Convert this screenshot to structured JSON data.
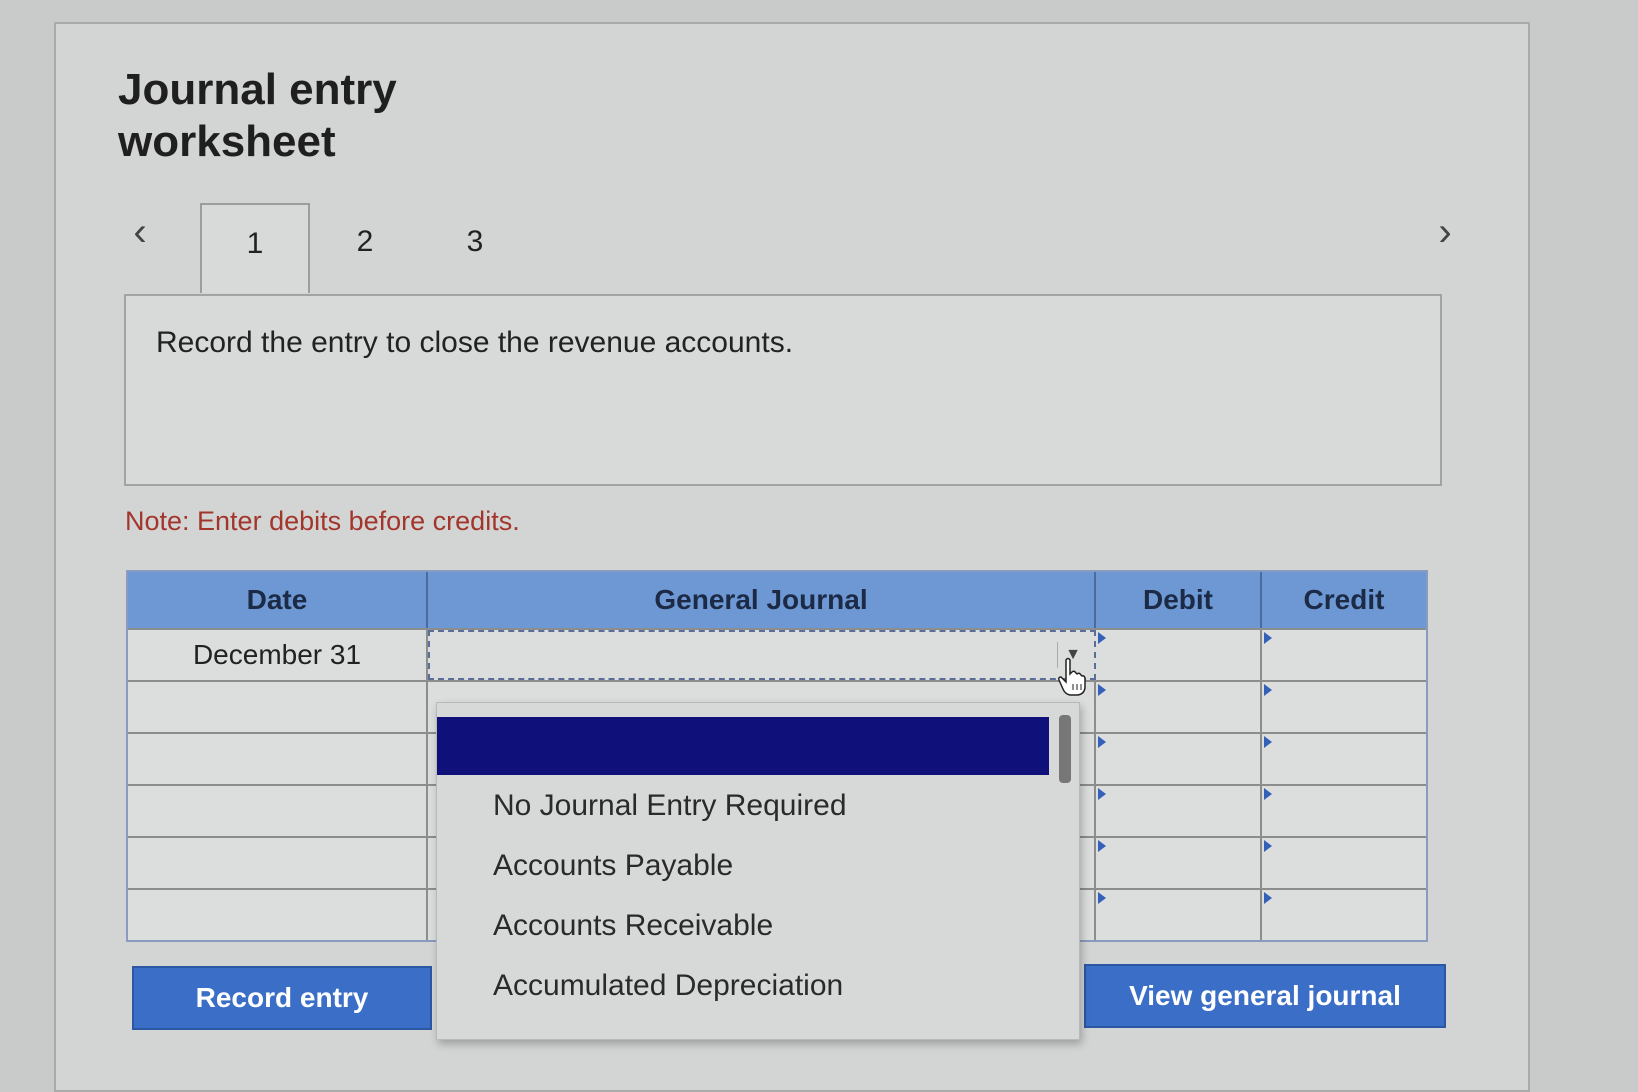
{
  "title": "Journal entry\nworksheet",
  "tabs": [
    "1",
    "2",
    "3"
  ],
  "active_tab": 0,
  "instruction": "Record the entry to close the revenue accounts.",
  "note": "Note: Enter debits before credits.",
  "table": {
    "headers": {
      "date": "Date",
      "general_journal": "General Journal",
      "debit": "Debit",
      "credit": "Credit"
    },
    "rows": [
      {
        "date": "December 31"
      },
      {
        "date": ""
      },
      {
        "date": ""
      },
      {
        "date": ""
      },
      {
        "date": ""
      },
      {
        "date": ""
      }
    ]
  },
  "dropdown": {
    "options": [
      "No Journal Entry Required",
      "Accounts Payable",
      "Accounts Receivable",
      "Accumulated Depreciation"
    ],
    "highlight_color": "#10107a"
  },
  "buttons": {
    "record": "Record entry",
    "view": "View general journal"
  },
  "colors": {
    "header_blue": "#6d98d4",
    "button_blue": "#3b6fc7",
    "note_red": "#a3362c"
  }
}
